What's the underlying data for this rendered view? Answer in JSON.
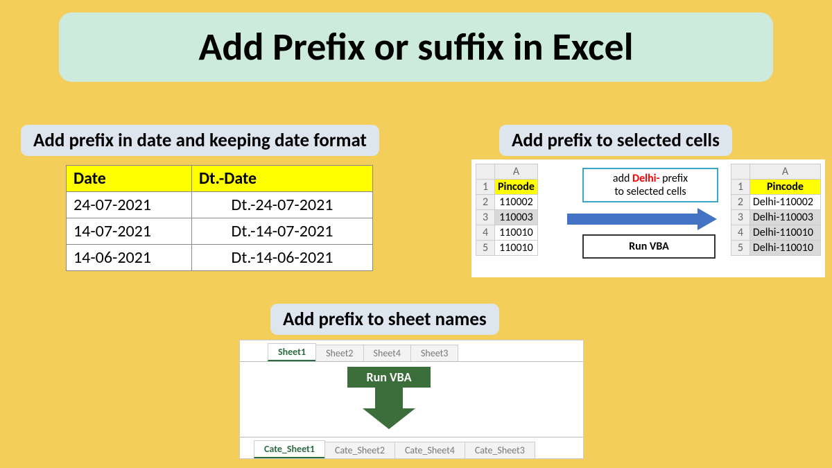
{
  "title": "Add Prefix or suffix in Excel",
  "section1": {
    "heading": "Add prefix in date and keeping date format",
    "headers": {
      "c1": "Date",
      "c2": "Dt.-Date"
    },
    "rows": [
      {
        "c1": "24-07-2021",
        "c2": "Dt.-24-07-2021"
      },
      {
        "c1": "14-07-2021",
        "c2": "Dt.-14-07-2021"
      },
      {
        "c1": "14-06-2021",
        "c2": "Dt.-14-06-2021"
      }
    ]
  },
  "section2": {
    "heading": "Add prefix to selected cells",
    "col_letter": "A",
    "left_header": "Pincode",
    "left_rows": [
      "110002",
      "110003",
      "110010",
      "110010"
    ],
    "bubble_prefix_word": "Delhi-",
    "bubble_prefix_rest": " prefix",
    "bubble_line1_prefix": "add ",
    "bubble_line2": "to selected cells",
    "run_vba": "Run VBA",
    "right_header": "Pincode",
    "right_rows": [
      "Delhi-110002",
      "Delhi-110003",
      "Delhi-110010",
      "Delhi-110010"
    ]
  },
  "section3": {
    "heading": "Add prefix to sheet names",
    "top_tabs": [
      "Sheet1",
      "Sheet2",
      "Sheet4",
      "Sheet3"
    ],
    "run_vba": "Run VBA",
    "bottom_tabs": [
      "Cate_Sheet1",
      "Cate_Sheet2",
      "Cate_Sheet4",
      "Cate_Sheet3"
    ]
  }
}
